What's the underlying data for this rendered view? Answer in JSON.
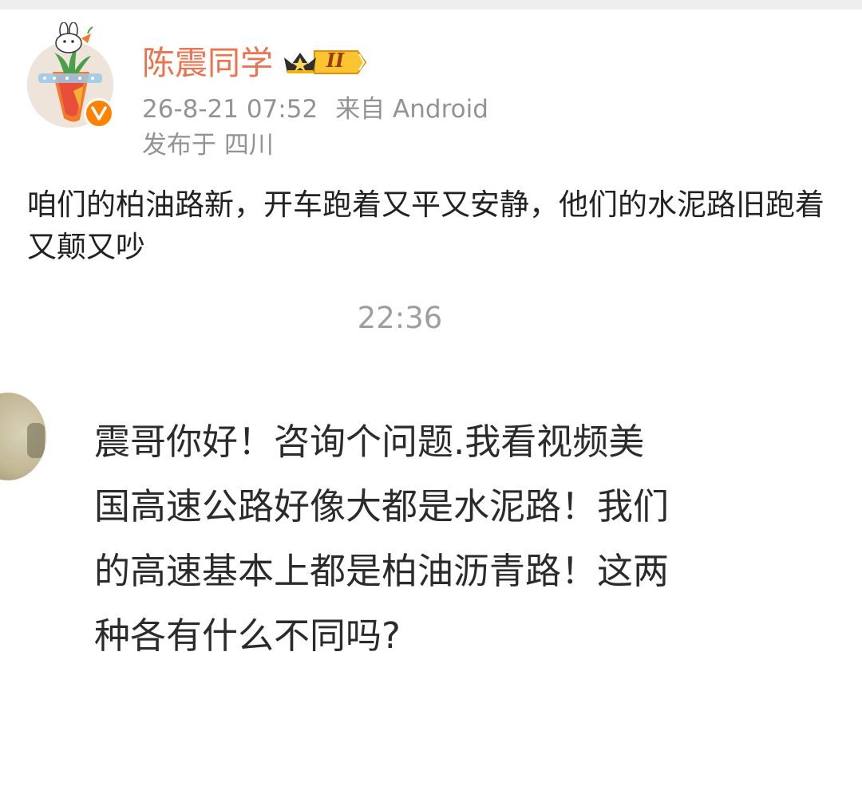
{
  "post": {
    "author": {
      "name": "陈震同学",
      "vip_level": "II",
      "verified_badge": "v"
    },
    "time": "26-8-21 07:52",
    "source": "来自 Android",
    "location": "发布于 四川",
    "text": "咱们的柏油路新，开车跑着又平又安静，他们的水泥路旧跑着又颠又吵"
  },
  "chat": {
    "timestamp": "22:36",
    "message": "震哥你好！咨询个问题.我看视频美国高速公路好像大都是水泥路！我们的高速基本上都是柏油沥青路！这两种各有什么不同吗?"
  },
  "colors": {
    "username": "#eb7350",
    "verified": "#ff8200",
    "meta_text": "#939393",
    "body_text": "#222222"
  },
  "icons": {
    "avatar": "carrot-avatar",
    "verified": "verified-v-icon",
    "vip": "crown-vip-badge-icon",
    "avatar_frame": "bunny-icon"
  }
}
